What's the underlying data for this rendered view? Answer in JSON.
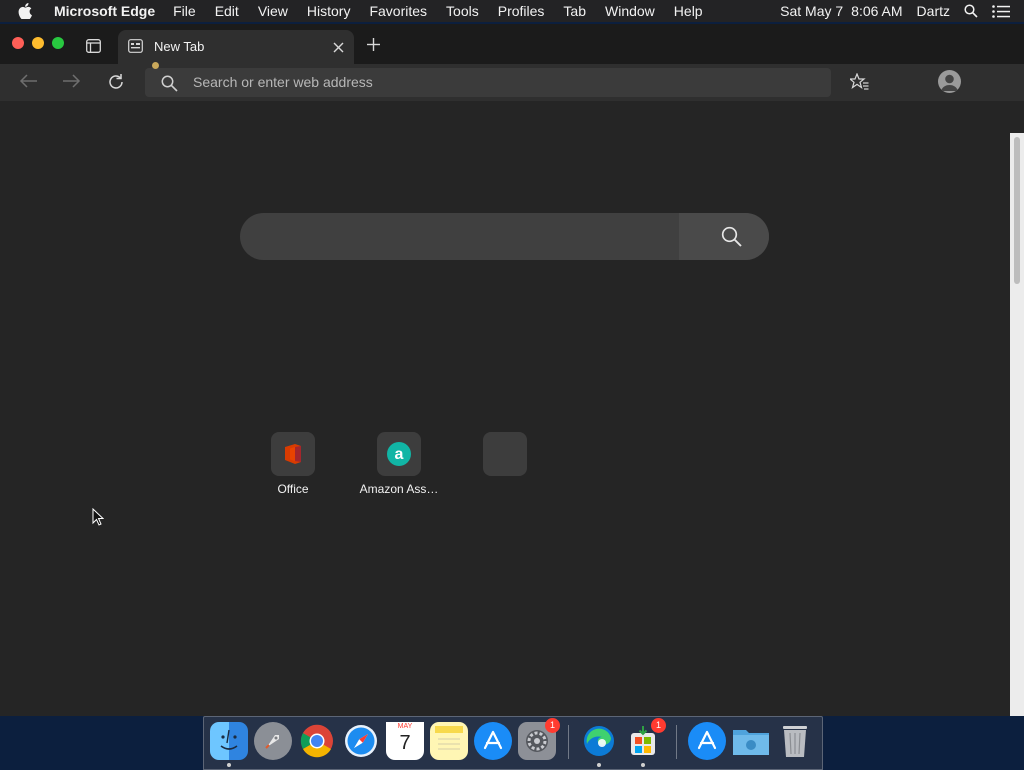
{
  "menubar": {
    "app_name": "Microsoft Edge",
    "items": [
      "File",
      "Edit",
      "View",
      "History",
      "Favorites",
      "Tools",
      "Profiles",
      "Tab",
      "Window",
      "Help"
    ],
    "date": "Sat May 7",
    "time": "8:06 AM",
    "user": "Dartz"
  },
  "tab": {
    "title": "New Tab"
  },
  "address_bar": {
    "placeholder": "Search or enter web address"
  },
  "quick_links": [
    {
      "label": "Office",
      "icon": "office-icon"
    },
    {
      "label": "Amazon Ass…",
      "icon": "amazon-assistant-icon"
    },
    {
      "label": "",
      "icon": "empty-tile"
    }
  ],
  "dock": {
    "apps": [
      {
        "name": "Finder",
        "icon": "finder-icon"
      },
      {
        "name": "Launchpad",
        "icon": "launchpad-icon"
      },
      {
        "name": "Google Chrome",
        "icon": "chrome-icon"
      },
      {
        "name": "Safari",
        "icon": "safari-icon"
      },
      {
        "name": "Calendar",
        "icon": "calendar-icon",
        "month": "MAY",
        "day": "7"
      },
      {
        "name": "Notes",
        "icon": "notes-icon"
      },
      {
        "name": "App Store",
        "icon": "app-store-icon"
      },
      {
        "name": "System Preferences",
        "icon": "system-preferences-icon",
        "badge": "1"
      },
      {
        "name": "Microsoft Edge",
        "icon": "edge-icon"
      },
      {
        "name": "Microsoft Installer",
        "icon": "microsoft-installer-icon",
        "badge": "1"
      },
      {
        "name": "Applications",
        "icon": "applications-folder-icon"
      },
      {
        "name": "Downloads",
        "icon": "downloads-folder-icon"
      },
      {
        "name": "Trash",
        "icon": "trash-icon"
      }
    ]
  },
  "colors": {
    "window_bg": "#252525",
    "menubar_bg": "#232325",
    "close": "#ff5f57",
    "minimize": "#febc2e",
    "maximize": "#28c840"
  }
}
